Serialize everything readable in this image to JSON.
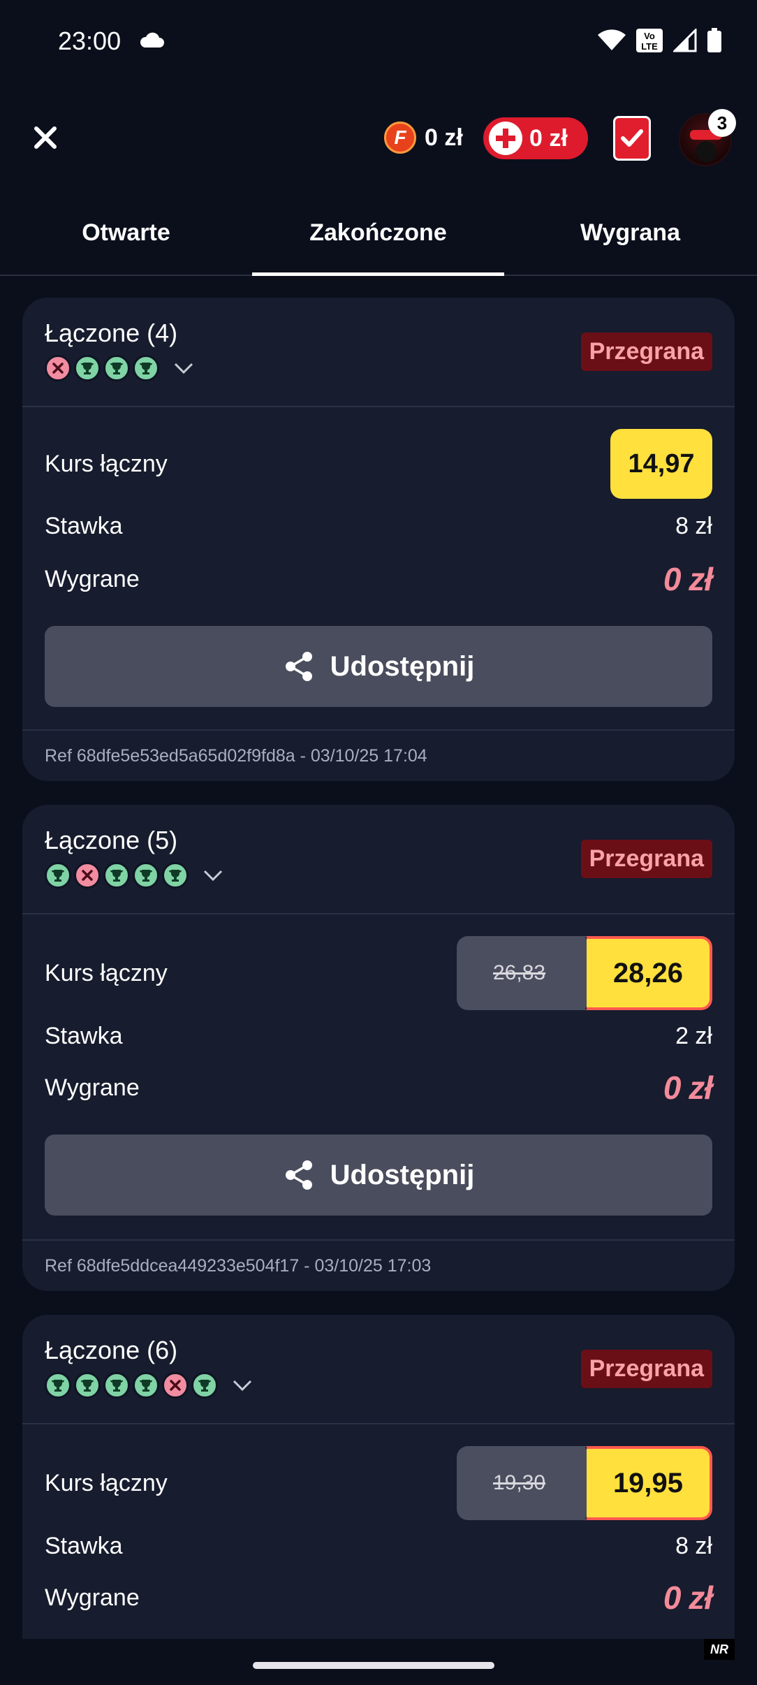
{
  "status_bar": {
    "time": "23:00",
    "volte_label_top": "Vo",
    "volte_label_bottom": "LTE"
  },
  "header": {
    "freebet_badge": "F",
    "freebet_balance": "0 zł",
    "deposit_balance": "0 zł",
    "notifications_count": "3"
  },
  "tabs": [
    {
      "label": "Otwarte",
      "active": false
    },
    {
      "label": "Zakończone",
      "active": true
    },
    {
      "label": "Wygrana",
      "active": false
    }
  ],
  "cards": [
    {
      "title": "Łączone (4)",
      "selections": [
        "lose",
        "win",
        "win",
        "win"
      ],
      "status": "Przegrana",
      "odds_label": "Kurs łączny",
      "odds": "14,97",
      "stake_label": "Stawka",
      "stake": "8 zł",
      "winnings_label": "Wygrane",
      "winnings": "0 zł",
      "share_label": "Udostępnij",
      "ref": "Ref 68dfe5e53ed5a65d02f9fd8a - 03/10/25 17:04"
    },
    {
      "title": "Łączone (5)",
      "selections": [
        "win",
        "lose",
        "win",
        "win",
        "win"
      ],
      "status": "Przegrana",
      "odds_label": "Kurs łączny",
      "odds_old": "26,83",
      "odds": "28,26",
      "stake_label": "Stawka",
      "stake": "2 zł",
      "winnings_label": "Wygrane",
      "winnings": "0 zł",
      "share_label": "Udostępnij",
      "ref": "Ref 68dfe5ddcea449233e504f17 - 03/10/25 17:03"
    },
    {
      "title": "Łączone (6)",
      "selections": [
        "win",
        "win",
        "win",
        "win",
        "lose",
        "win"
      ],
      "status": "Przegrana",
      "odds_label": "Kurs łączny",
      "odds_old": "19,30",
      "odds": "19,95",
      "stake_label": "Stawka",
      "stake": "8 zł",
      "winnings_label": "Wygrane",
      "winnings": "0 zł"
    }
  ],
  "watermark": "NR",
  "colors": {
    "background": "#0b0f1c",
    "card": "#171c2e",
    "lost_badge_bg": "#6b0f16",
    "lost_badge_text": "#f7a3a8",
    "odds_yellow": "#ffe03d",
    "win_dot": "#7fd3a5",
    "lose_dot": "#f28ca0",
    "brand_red": "#dd1b2d"
  }
}
